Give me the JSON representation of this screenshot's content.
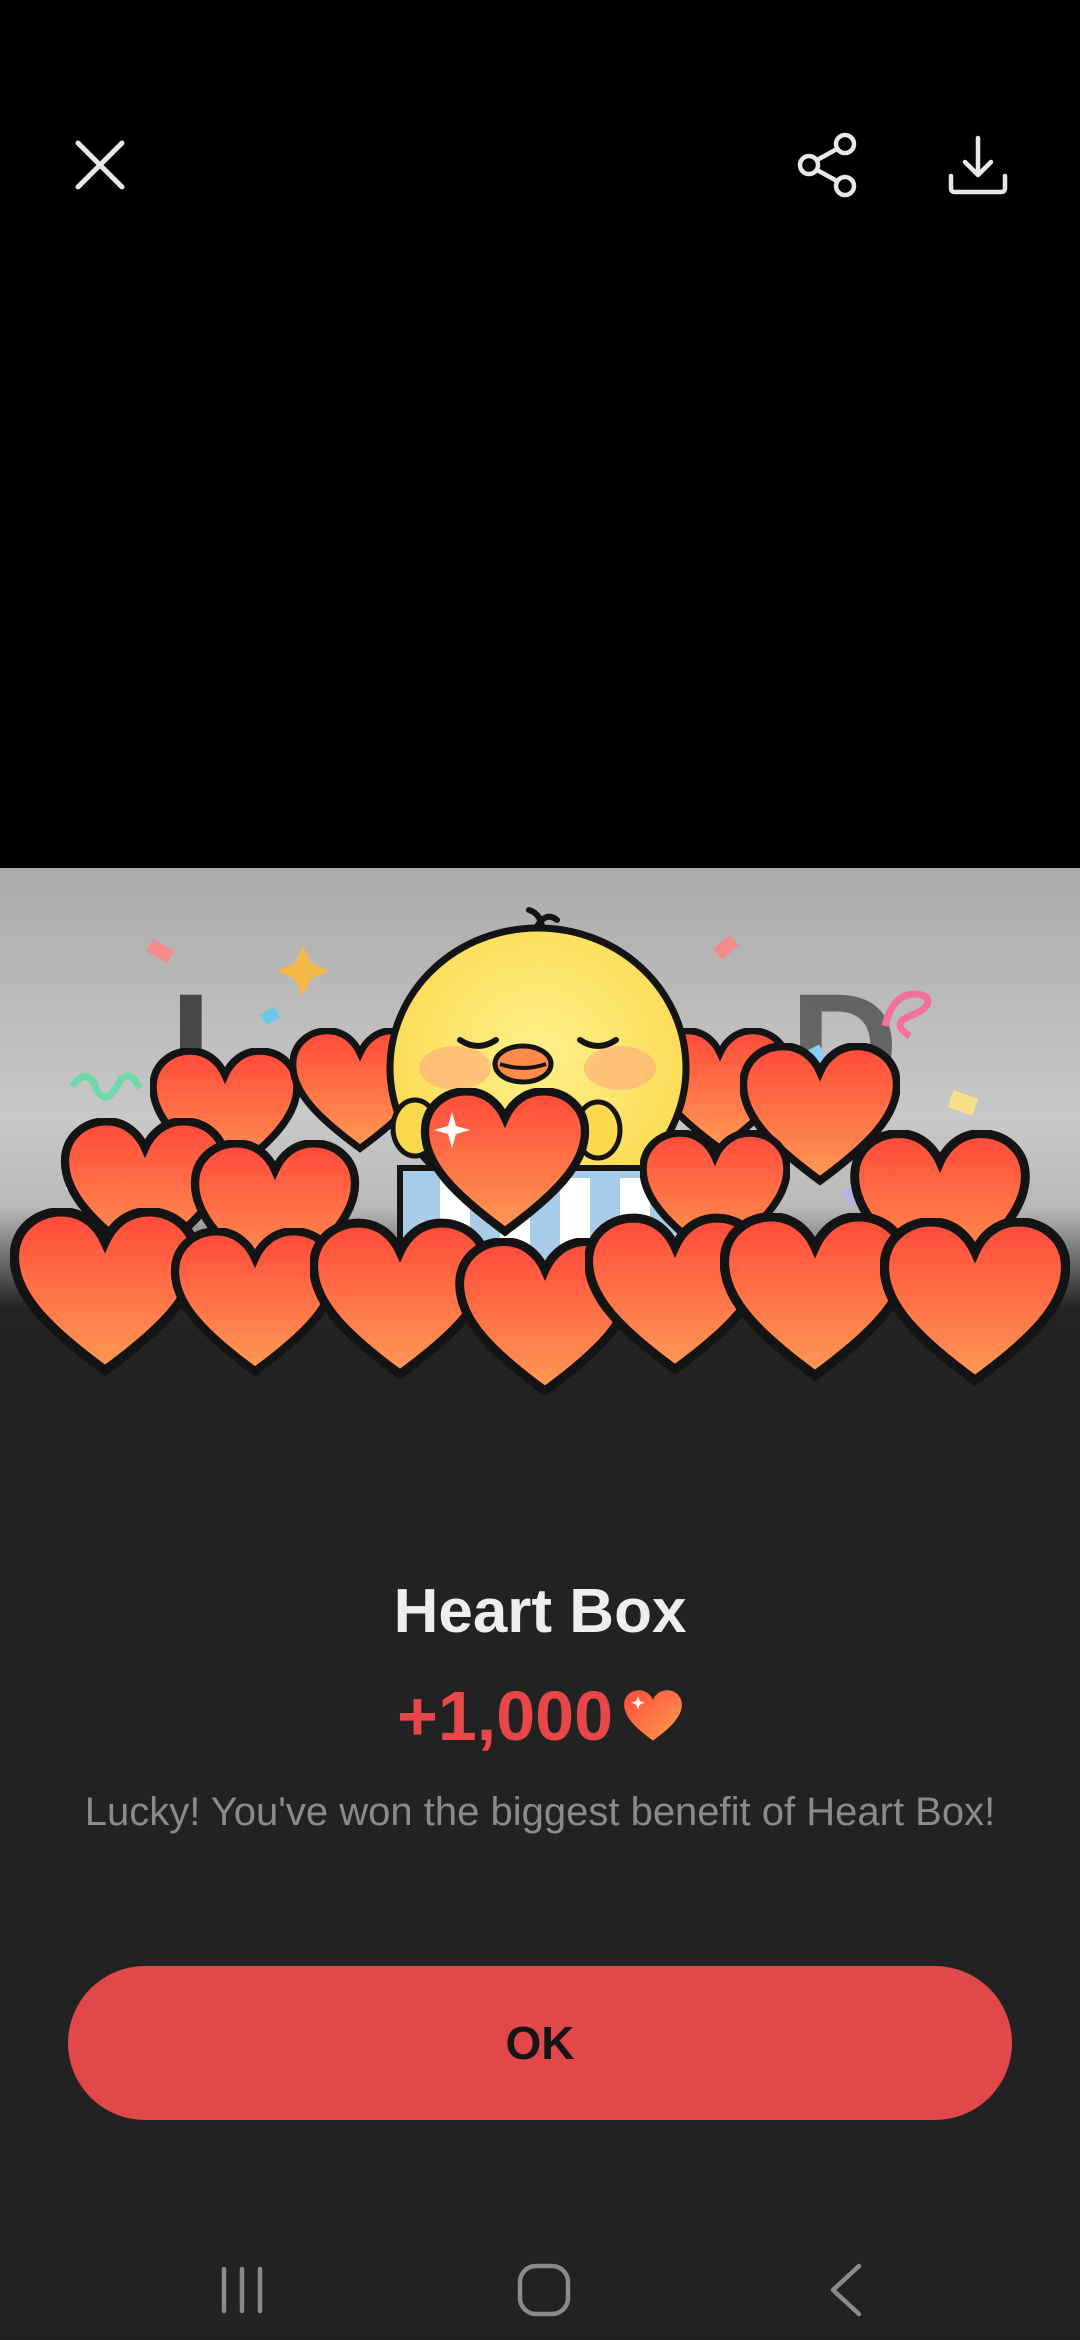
{
  "toolbar": {
    "close_icon": "close-icon",
    "share_icon": "share-icon",
    "download_icon": "download-icon"
  },
  "dialog": {
    "title": "Heart Box",
    "reward_amount": "+1,000",
    "reward_icon": "heart-icon",
    "message": "Lucky! You've won the biggest benefit of Heart Box!",
    "ok_label": "OK"
  },
  "navbar": {
    "recent_icon": "recent-apps-icon",
    "home_icon": "home-icon",
    "back_icon": "back-icon"
  },
  "colors": {
    "accent": "#e1484a",
    "reward_text": "#e8474a",
    "sheet_background": "#222222",
    "top_background": "#000000",
    "chick_yellow": "#fde86a",
    "heart_red": "#f65a3e"
  }
}
